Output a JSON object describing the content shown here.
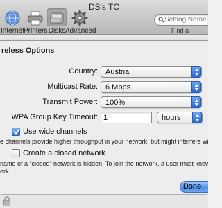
{
  "window": {
    "title": "DS's TC"
  },
  "toolbar": {
    "items": [
      {
        "label": "Internet",
        "icon": "globe-icon"
      },
      {
        "label": "Printers",
        "icon": "printer-icon"
      },
      {
        "label": "Disks",
        "icon": "disk-icon",
        "selected": true
      },
      {
        "label": "Advanced",
        "icon": "gear-icon"
      }
    ],
    "search": {
      "placeholder": "Setting Name",
      "label": "Find a setting"
    }
  },
  "sheet": {
    "title": "reless Options",
    "country": {
      "label": "Country:",
      "value": "Austria"
    },
    "multicast": {
      "label": "Multicast Rate:",
      "value": "6 Mbps"
    },
    "transmit": {
      "label": "Transmit Power:",
      "value": "100%"
    },
    "wpa": {
      "label": "WPA Group Key Timeout:",
      "value": "1",
      "unit": "hours"
    },
    "wide_channels": {
      "label": "Use wide channels",
      "checked": true,
      "help": "e channels provide higher throughput in your network, but might interfere with nearby networks."
    },
    "closed_network": {
      "label": "Create a closed network",
      "checked": false,
      "help_line1": "name of a “closed” network is hidden. To join the network, a user must know the name of the",
      "help_line2": "ork."
    },
    "done_label": "Done"
  },
  "colors": {
    "accent": "#3374db",
    "sheet_bg": "#ededed",
    "toolbar_top": "#dcdcdc"
  }
}
